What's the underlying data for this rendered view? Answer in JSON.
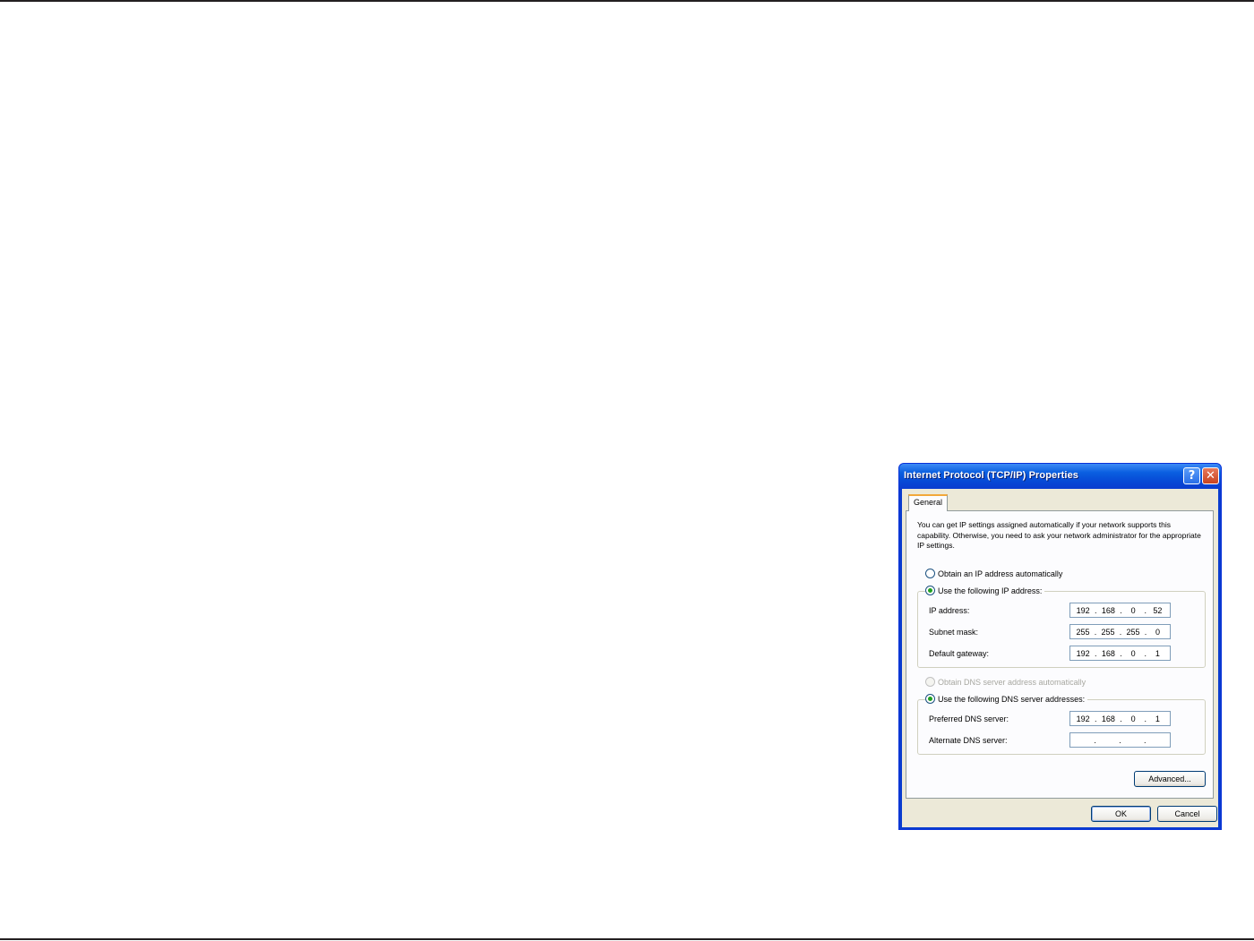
{
  "window": {
    "title": "Internet Protocol (TCP/IP) Properties",
    "help_glyph": "?",
    "close_glyph": "✕"
  },
  "tabs": [
    {
      "label": "General",
      "selected": true
    }
  ],
  "intro_text": "You can get IP settings assigned automatically if your network supports this capability. Otherwise, you need to ask your network administrator for the appropriate IP settings.",
  "ip_section": {
    "option_auto": {
      "label": "Obtain an IP address automatically",
      "checked": false
    },
    "option_manual": {
      "label": "Use the following IP address:",
      "checked": true
    },
    "fields": [
      {
        "label": "IP address:",
        "octets": [
          "192",
          "168",
          "0",
          "52"
        ]
      },
      {
        "label": "Subnet mask:",
        "octets": [
          "255",
          "255",
          "255",
          "0"
        ]
      },
      {
        "label": "Default gateway:",
        "octets": [
          "192",
          "168",
          "0",
          "1"
        ]
      }
    ]
  },
  "dns_section": {
    "option_auto": {
      "label": "Obtain DNS server address automatically",
      "checked": false,
      "disabled": true
    },
    "option_manual": {
      "label": "Use the following DNS server addresses:",
      "checked": true
    },
    "fields": [
      {
        "label": "Preferred DNS server:",
        "octets": [
          "192",
          "168",
          "0",
          "1"
        ]
      },
      {
        "label": "Alternate DNS server:",
        "octets": [
          "",
          "",
          "",
          ""
        ]
      }
    ]
  },
  "buttons": {
    "advanced": "Advanced...",
    "ok": "OK",
    "cancel": "Cancel"
  },
  "colors": {
    "titlebar": "#0a5fe0",
    "dialog_bg": "#ece9d8",
    "tab_accent": "#f2a83a"
  }
}
